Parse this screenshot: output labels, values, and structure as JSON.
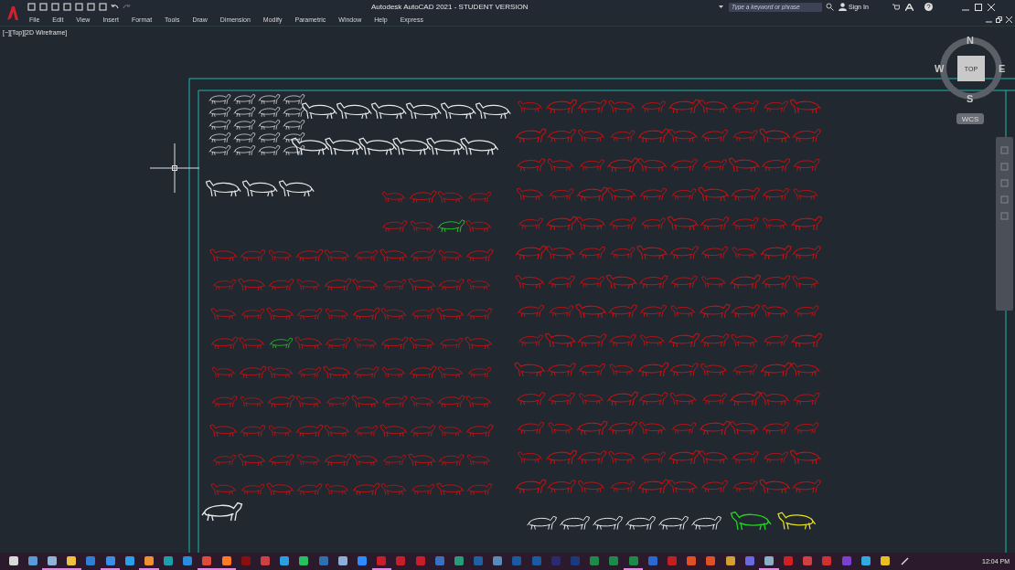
{
  "title_bar": {
    "title": "Autodesk AutoCAD 2021 - STUDENT VERSION",
    "search": {
      "placeholder": "Type a keyword or phrase"
    },
    "sign_in": "Sign In"
  },
  "menu": [
    "File",
    "Edit",
    "View",
    "Insert",
    "Format",
    "Tools",
    "Draw",
    "Dimension",
    "Modify",
    "Parametric",
    "Window",
    "Help",
    "Express"
  ],
  "viewport": {
    "label": "[−][Top][2D Wireframe]"
  },
  "viewcube": {
    "north": "N",
    "south": "S",
    "east": "E",
    "west": "W",
    "face": "TOP",
    "ucs": "WCS"
  },
  "taskbar": {
    "apps": [
      {
        "color": "#d9d9d9",
        "running": false
      },
      {
        "color": "#5a9bd5",
        "running": false
      },
      {
        "color": "#8fb4d8",
        "running": true
      },
      {
        "color": "#f0c040",
        "running": true
      },
      {
        "color": "#2f7fd6",
        "running": false
      },
      {
        "color": "#3a8ee6",
        "running": true
      },
      {
        "color": "#2aa0e6",
        "running": false
      },
      {
        "color": "#f09030",
        "running": true
      },
      {
        "color": "#1aa0a8",
        "running": false
      },
      {
        "color": "#2a8cdc",
        "running": false
      },
      {
        "color": "#e04a3a",
        "running": true
      },
      {
        "color": "#ff7a20",
        "running": true
      },
      {
        "color": "#8a1010",
        "running": false
      },
      {
        "color": "#d04040",
        "running": false
      },
      {
        "color": "#2a9ee0",
        "running": false
      },
      {
        "color": "#25c060",
        "running": false
      },
      {
        "color": "#3070b0",
        "running": false
      },
      {
        "color": "#8ab0d8",
        "running": false
      },
      {
        "color": "#2d8cff",
        "running": false
      },
      {
        "color": "#c81e2a",
        "running": true
      },
      {
        "color": "#c81e2a",
        "running": false
      },
      {
        "color": "#c81e2a",
        "running": false
      },
      {
        "color": "#3a70c0",
        "running": false
      },
      {
        "color": "#2a9a7a",
        "running": false
      },
      {
        "color": "#2060a0",
        "running": false
      },
      {
        "color": "#5a8ab8",
        "running": false
      },
      {
        "color": "#1a5aa0",
        "running": false
      },
      {
        "color": "#1a5aa0",
        "running": false
      },
      {
        "color": "#2a2a70",
        "running": false
      },
      {
        "color": "#1a3a80",
        "running": false
      },
      {
        "color": "#1e8a4a",
        "running": false
      },
      {
        "color": "#1e8a4a",
        "running": false
      },
      {
        "color": "#1e8a4a",
        "running": true
      },
      {
        "color": "#2a6ad0",
        "running": false
      },
      {
        "color": "#c02020",
        "running": false
      },
      {
        "color": "#e05020",
        "running": false
      },
      {
        "color": "#e05020",
        "running": false
      },
      {
        "color": "#d0a030",
        "running": false
      },
      {
        "color": "#6a6ae0",
        "running": false
      },
      {
        "color": "#8ab0c8",
        "running": true
      },
      {
        "color": "#d02020",
        "running": false
      },
      {
        "color": "#d04040",
        "running": false
      },
      {
        "color": "#d03030",
        "running": false
      },
      {
        "color": "#7a40d0",
        "running": false
      },
      {
        "color": "#30a8e0",
        "running": false
      },
      {
        "color": "#e8c020",
        "running": false
      }
    ],
    "clock": "12:04 PM"
  }
}
